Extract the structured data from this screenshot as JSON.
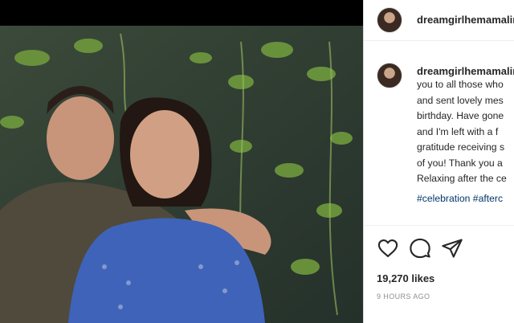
{
  "post": {
    "username": "dreamgirlhemamalini",
    "caption_lines": [
      "you to all those who",
      "and sent lovely mes",
      "birthday. Have gone",
      "and I'm left with a f",
      "gratitude receiving s",
      "of you! Thank you a",
      "Relaxing after the ce"
    ],
    "hashtags": "#celebration #afterc",
    "likes": "19,270 likes",
    "time_ago": "9 HOURS AGO"
  },
  "icons": {
    "like": "heart-icon",
    "comment": "comment-icon",
    "share": "share-icon"
  }
}
